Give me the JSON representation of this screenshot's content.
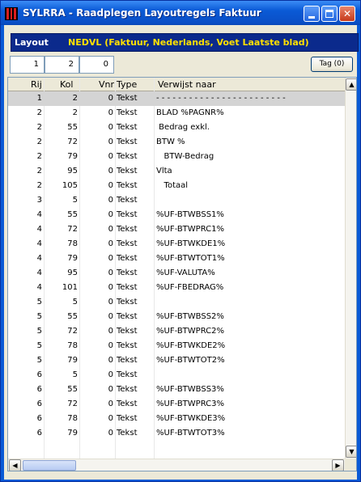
{
  "window": {
    "title": "SYLRRA - Raadplegen Layoutregels Faktuur",
    "minimize_label": "_",
    "maximize_label": "□",
    "close_label": "✕"
  },
  "layout": {
    "label": "Layout",
    "value": "NEDVL  (Faktuur, Nederlands, Voet Laatste blad)"
  },
  "position": {
    "rij": "1",
    "kol": "2",
    "vnr": "0"
  },
  "tag_button": "Tag (0)",
  "columns": [
    "Rij",
    "Kol",
    "Vnr",
    "Type",
    "Verwijst naar"
  ],
  "rows": [
    {
      "rij": "1",
      "kol": "2",
      "vnr": "0",
      "type": "Tekst",
      "ref": "- - - - - - - - - - - - - - - - - - - - - - - -"
    },
    {
      "rij": "2",
      "kol": "2",
      "vnr": "0",
      "type": "Tekst",
      "ref": "BLAD %PAGNR%"
    },
    {
      "rij": "2",
      "kol": "55",
      "vnr": "0",
      "type": "Tekst",
      "ref": " Bedrag exkl."
    },
    {
      "rij": "2",
      "kol": "72",
      "vnr": "0",
      "type": "Tekst",
      "ref": "BTW %"
    },
    {
      "rij": "2",
      "kol": "79",
      "vnr": "0",
      "type": "Tekst",
      "ref": "   BTW-Bedrag"
    },
    {
      "rij": "2",
      "kol": "95",
      "vnr": "0",
      "type": "Tekst",
      "ref": "Vlta"
    },
    {
      "rij": "2",
      "kol": "105",
      "vnr": "0",
      "type": "Tekst",
      "ref": "   Totaal"
    },
    {
      "rij": "3",
      "kol": "5",
      "vnr": "0",
      "type": "Tekst",
      "ref": ""
    },
    {
      "rij": "4",
      "kol": "55",
      "vnr": "0",
      "type": "Tekst",
      "ref": "%UF-BTWBSS1%"
    },
    {
      "rij": "4",
      "kol": "72",
      "vnr": "0",
      "type": "Tekst",
      "ref": "%UF-BTWPRC1%"
    },
    {
      "rij": "4",
      "kol": "78",
      "vnr": "0",
      "type": "Tekst",
      "ref": "%UF-BTWKDE1%"
    },
    {
      "rij": "4",
      "kol": "79",
      "vnr": "0",
      "type": "Tekst",
      "ref": "%UF-BTWTOT1%"
    },
    {
      "rij": "4",
      "kol": "95",
      "vnr": "0",
      "type": "Tekst",
      "ref": "%UF-VALUTA%"
    },
    {
      "rij": "4",
      "kol": "101",
      "vnr": "0",
      "type": "Tekst",
      "ref": "%UF-FBEDRAG%"
    },
    {
      "rij": "5",
      "kol": "5",
      "vnr": "0",
      "type": "Tekst",
      "ref": ""
    },
    {
      "rij": "5",
      "kol": "55",
      "vnr": "0",
      "type": "Tekst",
      "ref": "%UF-BTWBSS2%"
    },
    {
      "rij": "5",
      "kol": "72",
      "vnr": "0",
      "type": "Tekst",
      "ref": "%UF-BTWPRC2%"
    },
    {
      "rij": "5",
      "kol": "78",
      "vnr": "0",
      "type": "Tekst",
      "ref": "%UF-BTWKDE2%"
    },
    {
      "rij": "5",
      "kol": "79",
      "vnr": "0",
      "type": "Tekst",
      "ref": "%UF-BTWTOT2%"
    },
    {
      "rij": "6",
      "kol": "5",
      "vnr": "0",
      "type": "Tekst",
      "ref": ""
    },
    {
      "rij": "6",
      "kol": "55",
      "vnr": "0",
      "type": "Tekst",
      "ref": "%UF-BTWBSS3%"
    },
    {
      "rij": "6",
      "kol": "72",
      "vnr": "0",
      "type": "Tekst",
      "ref": "%UF-BTWPRC3%"
    },
    {
      "rij": "6",
      "kol": "78",
      "vnr": "0",
      "type": "Tekst",
      "ref": "%UF-BTWKDE3%"
    },
    {
      "rij": "6",
      "kol": "79",
      "vnr": "0",
      "type": "Tekst",
      "ref": "%UF-BTWTOT3%"
    }
  ],
  "selected_row": 0,
  "scroll_up": "▲",
  "scroll_down": "▼",
  "scroll_left": "◀",
  "scroll_right": "▶"
}
